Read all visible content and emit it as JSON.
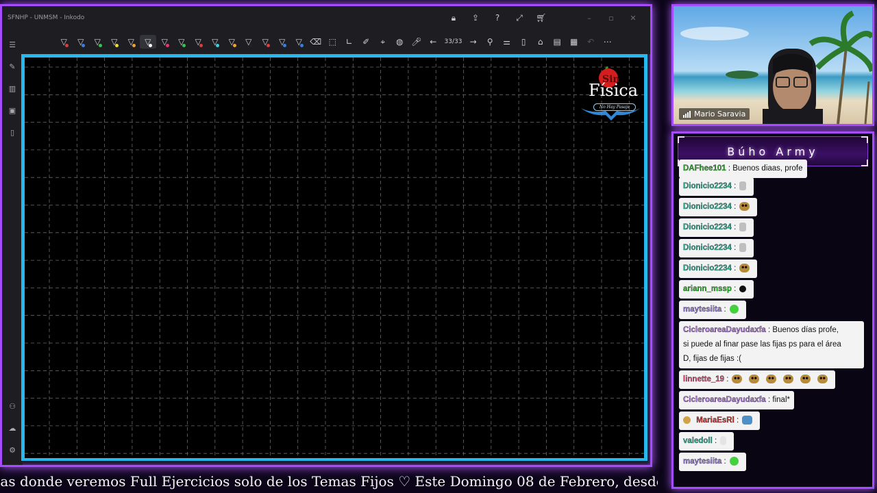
{
  "window": {
    "title": "SFNHP - UNMSM - Inkodo",
    "titlebar_icons": [
      "lock-icon",
      "share-icon",
      "help-icon",
      "expand-icon",
      "cart-icon"
    ],
    "window_controls": [
      "minimize-icon",
      "maximize-icon",
      "close-icon"
    ]
  },
  "toolbar": {
    "pen_colors": [
      "#e03a3a",
      "#3a7de0",
      "#3ac24a",
      "#e8e03a",
      "#f0a030",
      "#ffffff",
      "#e03a6a",
      "#3ac24a",
      "#e03a3a",
      "#3ad0e0",
      "#f0a030",
      "#222222",
      "#e03a3a",
      "#3a7de0",
      "#3a7de0"
    ],
    "page_indicator": "33/33",
    "tool_icons": [
      "eraser-icon",
      "select-icon",
      "ruler-icon",
      "highlighter-icon",
      "laser-icon",
      "globe-icon",
      "mic-icon",
      "prev-page-icon",
      "next-page-icon",
      "zoom-icon",
      "settings-icon",
      "new-page-icon",
      "open-icon",
      "save-icon",
      "paste-icon",
      "undo-icon",
      "more-icon"
    ]
  },
  "sidebar": {
    "icons": [
      "menu-icon",
      "pen-icon",
      "library-icon",
      "slides-icon",
      "clipboard-icon",
      "user-settings-icon",
      "cloud-icon",
      "gear-icon"
    ]
  },
  "board": {
    "logo": {
      "main": "Física",
      "sub": "No Hay Pasaje"
    }
  },
  "webcam": {
    "name": "Mario Saravia"
  },
  "chat": {
    "title": "Búho Army",
    "messages": [
      {
        "user": "DAFhee101",
        "user_color": "#3fae3f",
        "text": ": Buenos diaas, profe",
        "emoji": []
      },
      {
        "user": "Dionicio2234",
        "user_color": "#39b39a",
        "text": ":",
        "emoji": [
          "cat"
        ]
      },
      {
        "user": "Dionicio2234",
        "user_color": "#39b39a",
        "text": ":",
        "emoji": [
          "dog"
        ]
      },
      {
        "user": "Dionicio2234",
        "user_color": "#39b39a",
        "text": ":",
        "emoji": [
          "cat"
        ]
      },
      {
        "user": "Dionicio2234",
        "user_color": "#39b39a",
        "text": ":",
        "emoji": [
          "cat"
        ]
      },
      {
        "user": "Dionicio2234",
        "user_color": "#39b39a",
        "text": ":",
        "emoji": [
          "dog"
        ]
      },
      {
        "user": "ariann_mssp",
        "user_color": "#2fbf2f",
        "text": ":",
        "emoji": [
          "black"
        ]
      },
      {
        "user": "maytesiita",
        "user_color": "#9a7fe0",
        "text": ":",
        "emoji": [
          "green"
        ]
      },
      {
        "user": "CicleroareaDayudaxfa",
        "user_color": "#b07ad8",
        "text": ": Buenos días profe,",
        "line2": "si puede al finar pase las fijas ps para el área",
        "line3": "D, fijas de fijas :(",
        "emoji": []
      },
      {
        "user": "linnette_19",
        "user_color": "#e0507a",
        "text": ":",
        "emoji": [
          "dog",
          "dog",
          "dog",
          "dog",
          "dog",
          "dog"
        ]
      },
      {
        "user": "CicleroareaDayudaxfa",
        "user_color": "#b07ad8",
        "text": ": final*",
        "emoji": []
      },
      {
        "user": "MariaEsRl",
        "user_color": "#d23b3b",
        "text": ":",
        "emoji": [
          "frog"
        ],
        "badge": true
      },
      {
        "user": "valedoll",
        "user_color": "#39b39a",
        "text": ":",
        "emoji": [
          "ghost"
        ]
      },
      {
        "user": "maytesiita",
        "user_color": "#9a7fe0",
        "text": ":",
        "emoji": [
          "green"
        ]
      }
    ]
  },
  "ticker": {
    "text": "ias donde veremos Full Ejercicios solo de los Temas Fijos ♡  Este Domingo 08 de Febrero, desde"
  }
}
